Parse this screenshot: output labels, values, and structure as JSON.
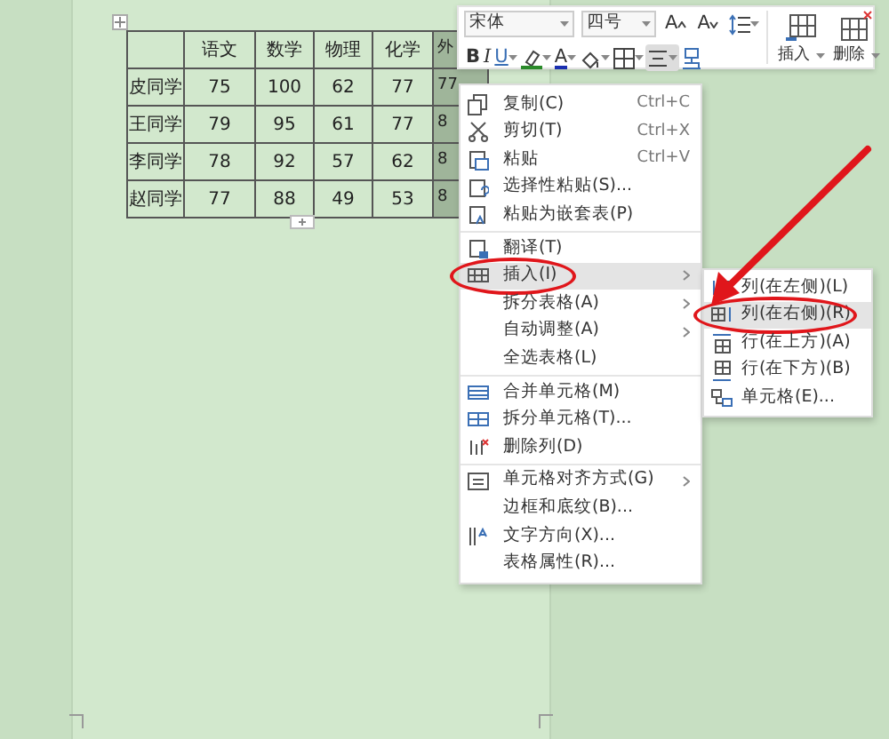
{
  "table": {
    "columns": [
      {
        "selected": false
      },
      {
        "label": "语文",
        "selected": false
      },
      {
        "label": "数学",
        "selected": false
      },
      {
        "label": "物理",
        "selected": false
      },
      {
        "label": "化学",
        "selected": false
      },
      {
        "label": "外",
        "selected": true
      }
    ],
    "rows": [
      [
        "皮同学",
        "75",
        "100",
        "62",
        "77",
        "77"
      ],
      [
        "王同学",
        "79",
        "95",
        "61",
        "77",
        "8"
      ],
      [
        "李同学",
        "78",
        "92",
        "57",
        "62",
        "8"
      ],
      [
        "赵同学",
        "77",
        "88",
        "49",
        "53",
        "8"
      ]
    ]
  },
  "toolbar": {
    "font_name": "宋体",
    "font_size": "四号",
    "row_1": [
      {
        "kind": "grow-font",
        "label": "A"
      },
      {
        "kind": "shrink-font",
        "label": "A"
      },
      {
        "kind": "line-spacing"
      }
    ],
    "row_2": [
      {
        "kind": "bold",
        "label": "B",
        "selected": false
      },
      {
        "kind": "italic",
        "label": "I",
        "selected": false
      },
      {
        "kind": "underline",
        "label": "U",
        "selected": false
      },
      {
        "kind": "highlight",
        "selected": false
      },
      {
        "kind": "font-color",
        "label": "A",
        "selected": false
      },
      {
        "kind": "shading",
        "selected": false
      },
      {
        "kind": "borders",
        "selected": false
      },
      {
        "kind": "align",
        "selected": true
      },
      {
        "kind": "painter",
        "selected": false
      }
    ],
    "big_buttons": [
      {
        "kind": "insert",
        "label": "插入"
      },
      {
        "kind": "delete",
        "label": "删除"
      }
    ]
  },
  "context_menu": [
    {
      "kind": "copy",
      "label": "复制(C)",
      "shortcut": "Ctrl+C",
      "submenu": false,
      "selected": false,
      "circled": false
    },
    {
      "kind": "cut",
      "label": "剪切(T)",
      "shortcut": "Ctrl+X",
      "submenu": false,
      "selected": false,
      "circled": false
    },
    {
      "kind": "paste",
      "label": "粘贴",
      "shortcut": "Ctrl+V",
      "submenu": false,
      "selected": false,
      "circled": false
    },
    {
      "kind": "paste-special",
      "label": "选择性粘贴(S)...",
      "submenu": false,
      "selected": false,
      "circled": false
    },
    {
      "kind": "paste-nested",
      "label": "粘贴为嵌套表(P)",
      "submenu": false,
      "selected": false,
      "circled": false
    },
    {
      "kind": "separator"
    },
    {
      "kind": "translate",
      "label": "翻译(T)",
      "submenu": false,
      "selected": false,
      "circled": false
    },
    {
      "kind": "insert",
      "label": "插入(I)",
      "submenu": true,
      "selected": true,
      "circled": true
    },
    {
      "kind": "plain",
      "label": "拆分表格(A)",
      "submenu": true,
      "selected": false,
      "circled": false
    },
    {
      "kind": "plain",
      "label": "自动调整(A)",
      "submenu": true,
      "selected": false,
      "circled": false
    },
    {
      "kind": "plain",
      "label": "全选表格(L)",
      "submenu": false,
      "selected": false,
      "circled": false
    },
    {
      "kind": "separator"
    },
    {
      "kind": "merge",
      "label": "合并单元格(M)",
      "submenu": false,
      "selected": false,
      "circled": false
    },
    {
      "kind": "split",
      "label": "拆分单元格(T)...",
      "submenu": false,
      "selected": false,
      "circled": false
    },
    {
      "kind": "delete-column",
      "label": "删除列(D)",
      "submenu": false,
      "selected": false,
      "circled": false
    },
    {
      "kind": "separator"
    },
    {
      "kind": "align",
      "label": "单元格对齐方式(G)",
      "submenu": true,
      "selected": false,
      "circled": false
    },
    {
      "kind": "plain",
      "label": "边框和底纹(B)...",
      "submenu": false,
      "selected": false,
      "circled": false
    },
    {
      "kind": "text-direction",
      "label": "文字方向(X)...",
      "submenu": false,
      "selected": false,
      "circled": false
    },
    {
      "kind": "plain",
      "label": "表格属性(R)...",
      "submenu": false,
      "selected": false,
      "circled": false
    }
  ],
  "submenu": [
    {
      "kind": "col-left",
      "label": "列(在左侧)(L)",
      "selected": false,
      "circled": false
    },
    {
      "kind": "col-right",
      "label": "列(在右侧)(R)",
      "selected": true,
      "circled": true
    },
    {
      "kind": "row-above",
      "label": "行(在上方)(A)",
      "selected": false,
      "circled": false
    },
    {
      "kind": "row-below",
      "label": "行(在下方)(B)",
      "selected": false,
      "circled": false
    },
    {
      "kind": "cell",
      "label": "单元格(E)...",
      "selected": false,
      "circled": false
    }
  ]
}
